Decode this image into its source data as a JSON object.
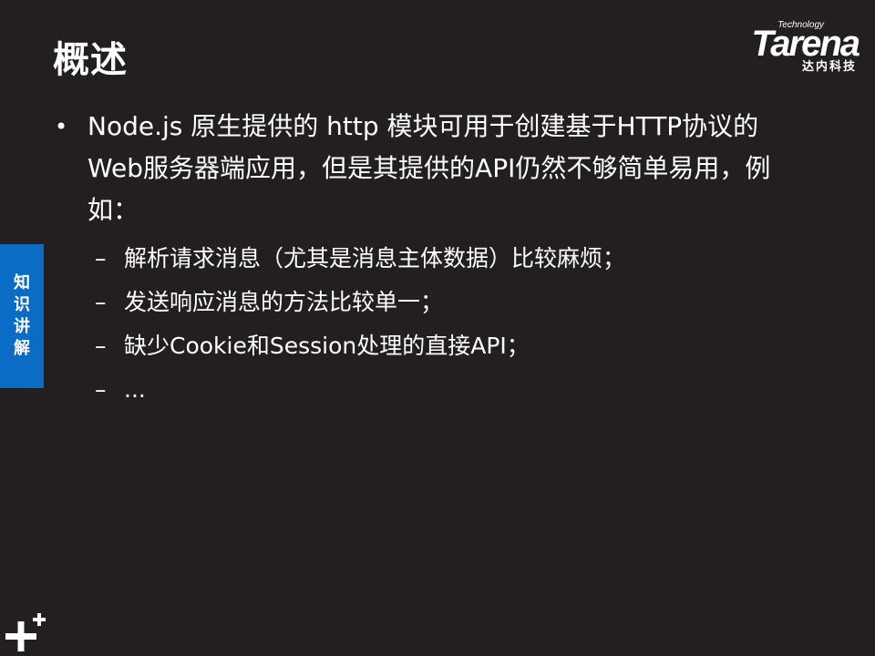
{
  "slide": {
    "title": "概述",
    "side_tab": "知识讲解",
    "logo": {
      "small": "Technology",
      "word": "Tarena",
      "cn": "达内科技"
    },
    "bullet": {
      "marker": "•",
      "text": "Node.js 原生提供的 http 模块可用于创建基于HTTP协议的Web服务器端应用，但是其提供的API仍然不够简单易用，例如："
    },
    "sub_marker": "–",
    "sub_items": [
      "解析请求消息（尤其是消息主体数据）比较麻烦；",
      "发送响应消息的方法比较单一；",
      "缺少Cookie和Session处理的直接API；",
      "..."
    ]
  },
  "colors": {
    "background": "#231f20",
    "side_tab": "#0a6cc5",
    "text": "#ffffff"
  }
}
